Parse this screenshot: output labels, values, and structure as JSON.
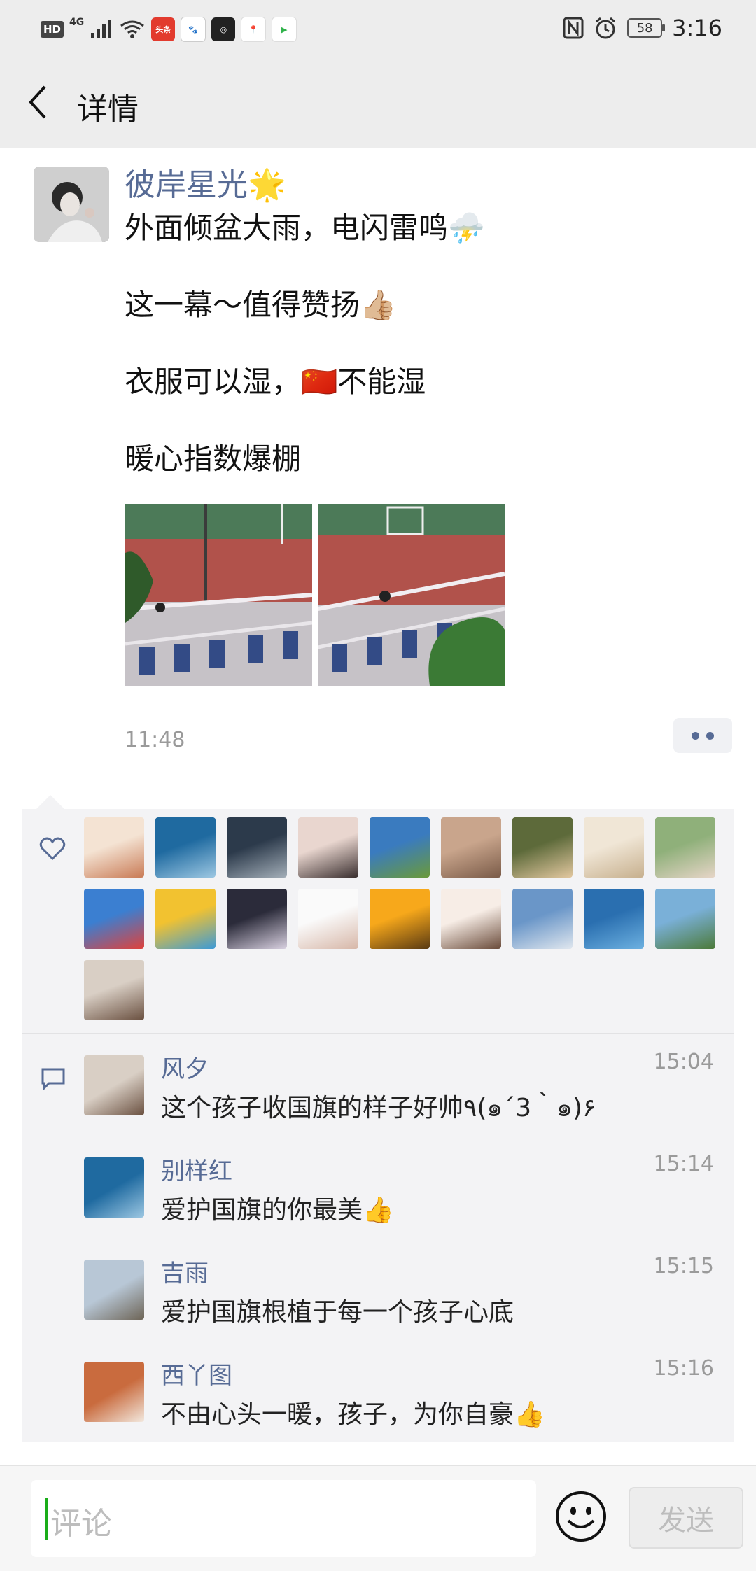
{
  "status_bar": {
    "hd": "HD",
    "network": "4G",
    "battery": "58",
    "time": "3:16",
    "app_icons": [
      "头条",
      "百度",
      "爱奇艺"
    ]
  },
  "header": {
    "title": "详情",
    "back_icon": "chevron-left-icon"
  },
  "post": {
    "author": "彼岸星光🌟",
    "lines": [
      "外面倾盆大雨，电闪雷鸣⛈️",
      "这一幕～值得赞扬👍🏼",
      "衣服可以湿，🇨🇳不能湿",
      "暖心指数爆棚"
    ],
    "time": "11:48",
    "photos": [
      "photo-1",
      "photo-2"
    ]
  },
  "likes": {
    "icon": "heart-icon",
    "avatar_colors": [
      [
        "#f4e3d3",
        "#c97b56"
      ],
      [
        "#1f6aa0",
        "#9cc7e2"
      ],
      [
        "#2c3a4b",
        "#a3aeb8"
      ],
      [
        "#e9d6cf",
        "#3a2f2f"
      ],
      [
        "#3a7bbf",
        "#6a9a3a"
      ],
      [
        "#c9a58c",
        "#7a5b48"
      ],
      [
        "#5d6a3a",
        "#e2c79f"
      ],
      [
        "#f0e6d6",
        "#c7b08e"
      ],
      [
        "#8fb07a",
        "#e6d5c7"
      ],
      [
        "#3b7fd1",
        "#e0413b"
      ],
      [
        "#f2c230",
        "#3d9ad6"
      ],
      [
        "#2b2b3a",
        "#d8d0e0"
      ],
      [
        "#fafafa",
        "#d7b7a8"
      ],
      [
        "#f7a81b",
        "#5a3a12"
      ],
      [
        "#f7ede6",
        "#6a4b3a"
      ],
      [
        "#6a96c8",
        "#dfe6ee"
      ],
      [
        "#2a6fb0",
        "#6cb0e0"
      ],
      [
        "#7ab0d8",
        "#4c7a3a"
      ],
      [
        "#d9cfc5",
        "#6a5040"
      ]
    ]
  },
  "comments": [
    {
      "name": "风夕",
      "time": "15:04",
      "text": "这个孩子收国旗的样子好帅٩(๑´3｀๑)۶",
      "avatar": [
        "#d9cfc5",
        "#6a5040"
      ]
    },
    {
      "name": "别样红",
      "time": "15:14",
      "text": "爱护国旗的你最美👍",
      "avatar": [
        "#1f6aa0",
        "#9cc7e2"
      ]
    },
    {
      "name": "吉雨",
      "time": "15:15",
      "text": "爱护国旗根植于每一个孩子心底",
      "avatar": [
        "#b8c7d6",
        "#6d6456"
      ]
    },
    {
      "name": "西丫图",
      "time": "15:16",
      "text": "不由心头一暖，孩子，为你自豪👍",
      "avatar": [
        "#c96b3e",
        "#f2e8de"
      ]
    }
  ],
  "comment_bar": {
    "placeholder": "评论",
    "send_label": "发送",
    "emoji_icon": "smiley-icon"
  }
}
